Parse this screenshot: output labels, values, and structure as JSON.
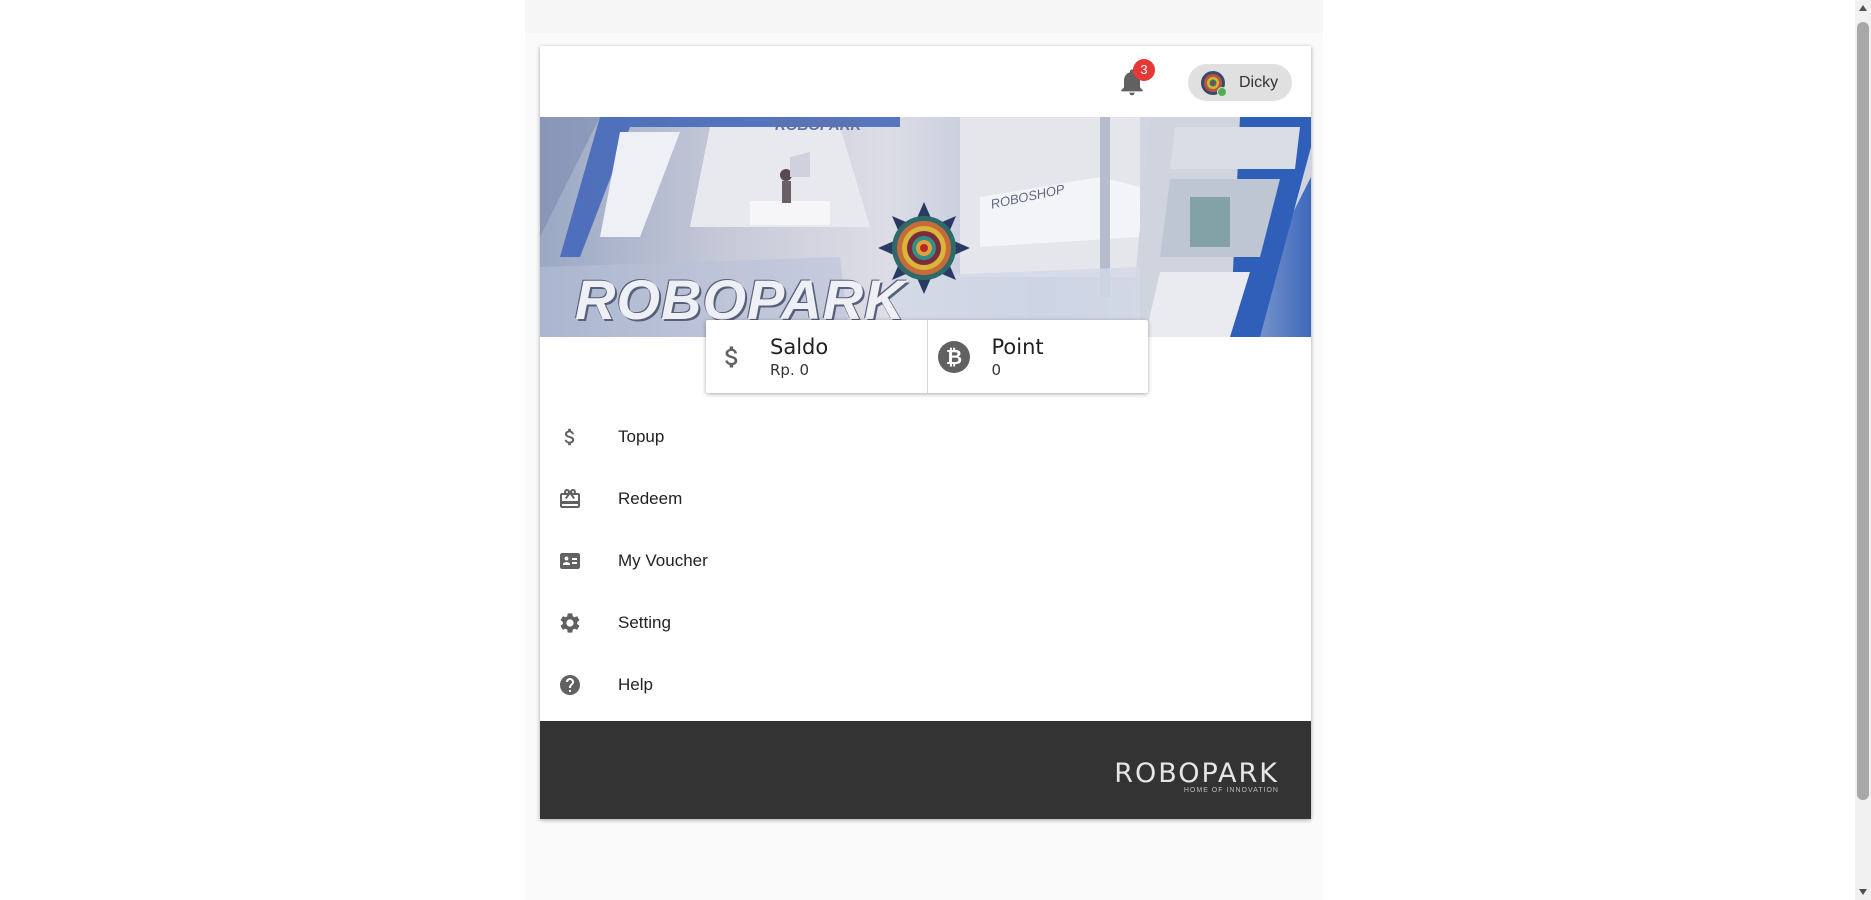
{
  "header": {
    "notification_count": "3",
    "user_name": "Dicky",
    "bell_icon": "bell-icon",
    "avatar_icon": "avatar-mandala"
  },
  "banner": {
    "main_text": "ROBOPARK",
    "sign_text": "ROBOPARK",
    "shop_text": "ROBOSHOP"
  },
  "stats": {
    "saldo": {
      "title": "Saldo",
      "value": "Rp. 0",
      "icon": "dollar-icon"
    },
    "point": {
      "title": "Point",
      "value": "0",
      "icon": "bitcoin-icon"
    }
  },
  "menu": [
    {
      "label": "Topup",
      "icon": "dollar-icon"
    },
    {
      "label": "Redeem",
      "icon": "gift-icon"
    },
    {
      "label": "My Voucher",
      "icon": "voucher-icon"
    },
    {
      "label": "Setting",
      "icon": "gear-icon"
    },
    {
      "label": "Help",
      "icon": "help-icon"
    }
  ],
  "footer": {
    "logo_text": "ROBOPARK",
    "tagline": "HOME OF INNOVATION"
  },
  "colors": {
    "badge": "#e53935",
    "footer_bg": "#333333",
    "online_dot": "#4caf50",
    "icon_gray": "#616161"
  }
}
